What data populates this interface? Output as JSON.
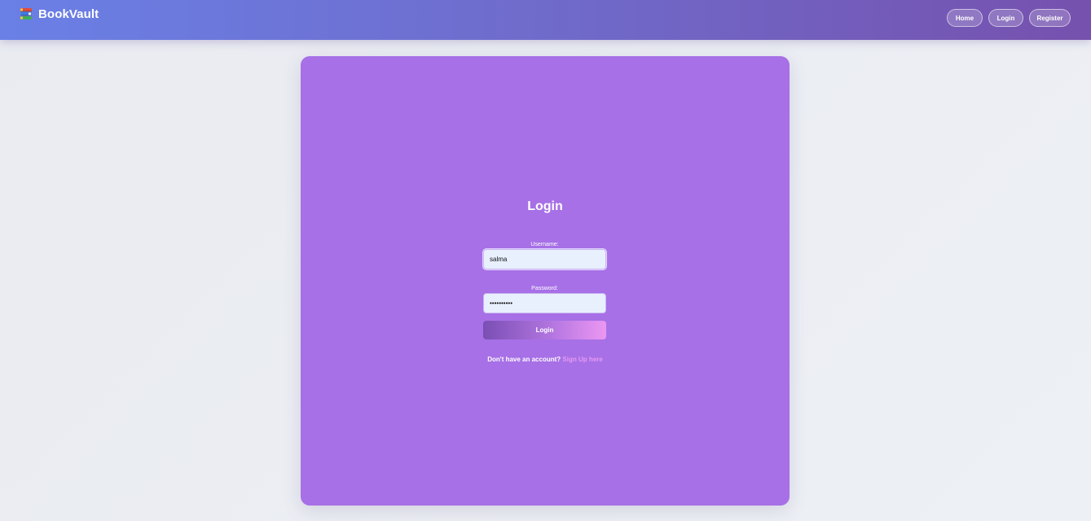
{
  "navbar": {
    "brand_icon": "books-icon",
    "brand_name": "BookVault",
    "links": {
      "home": "Home",
      "login": "Login",
      "register": "Register"
    }
  },
  "form": {
    "title": "Login",
    "username": {
      "label": "Username:",
      "value": "salma"
    },
    "password": {
      "label": "Password:",
      "value": "••••••••••"
    },
    "submit_label": "Login",
    "signup_prompt": "Don't have an account?",
    "signup_link": "Sign Up here"
  },
  "colors": {
    "navbar_gradient_start": "#6a80e6",
    "navbar_gradient_end": "#7651ae",
    "card_background": "#a770e6",
    "input_background": "#e8f0fe",
    "link_color": "#e69af4"
  }
}
